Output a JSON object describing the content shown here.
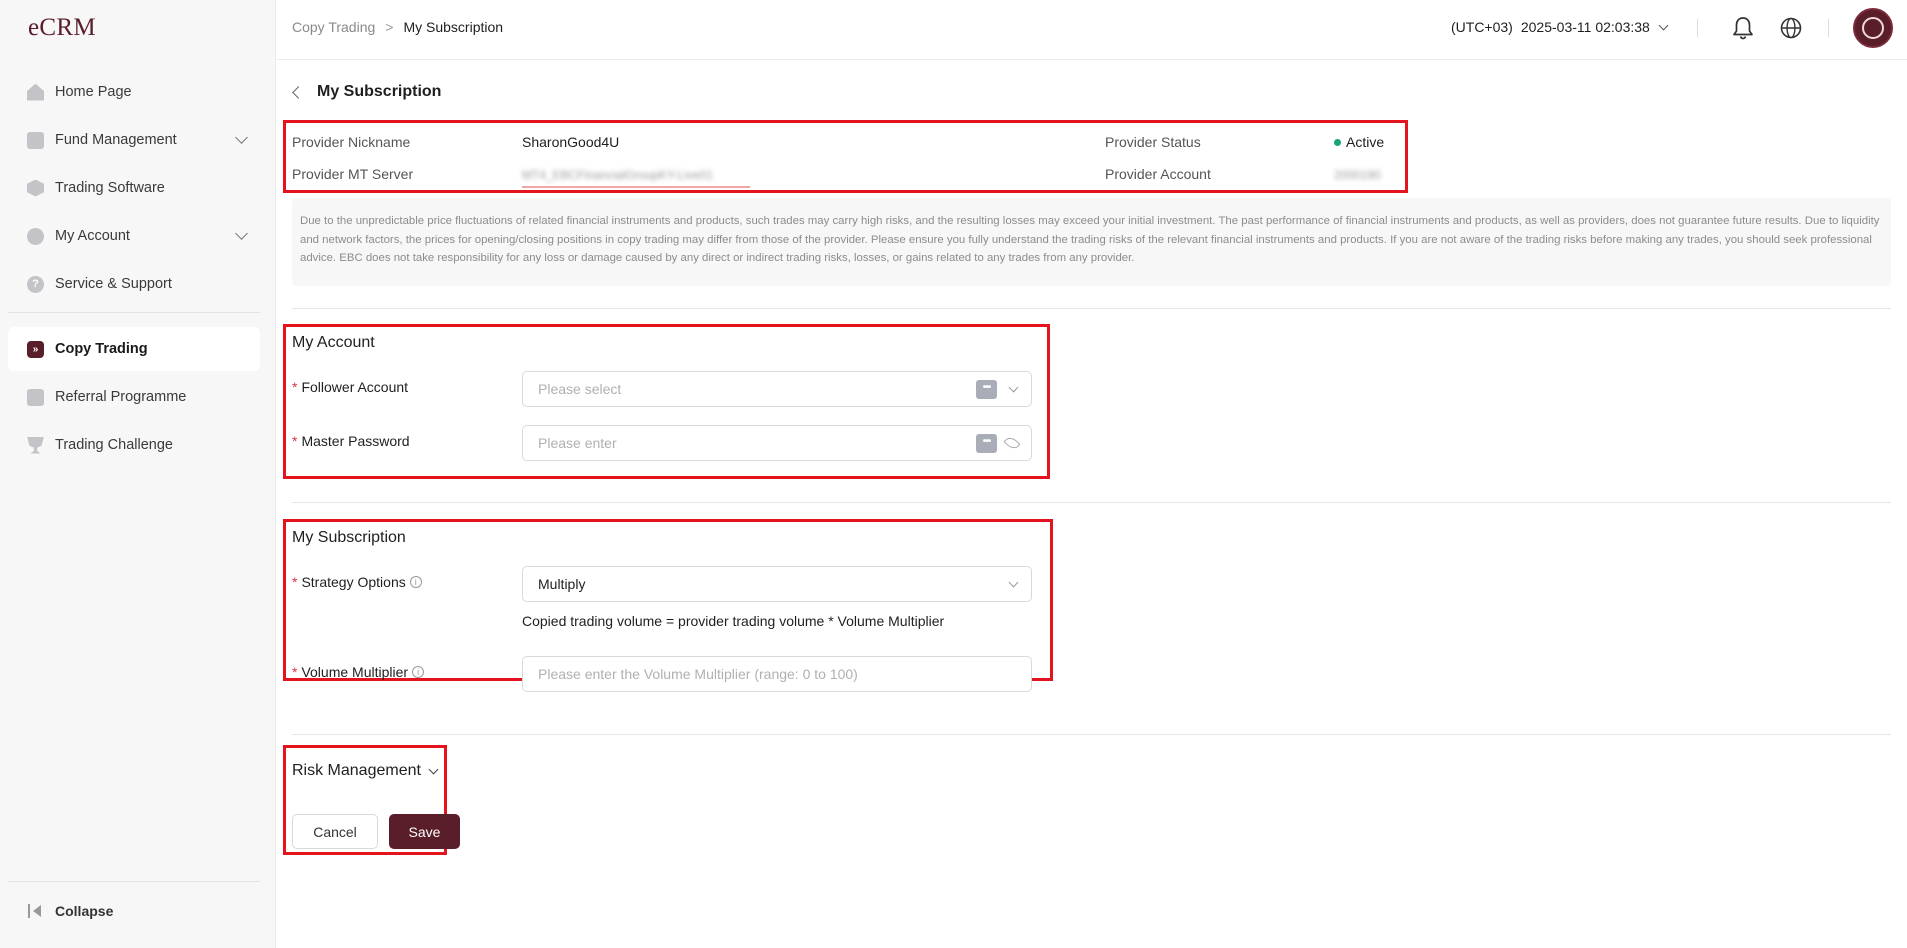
{
  "app": {
    "logo": "eCRM"
  },
  "sidebar": {
    "items": [
      {
        "label": "Home Page",
        "icon": "home-icon"
      },
      {
        "label": "Fund Management",
        "icon": "fund-icon",
        "expandable": true
      },
      {
        "label": "Trading Software",
        "icon": "cube-icon"
      },
      {
        "label": "My Account",
        "icon": "user-icon",
        "expandable": true
      },
      {
        "label": "Service & Support",
        "icon": "help-icon"
      },
      {
        "label": "Copy Trading",
        "icon": "copy-trading-icon",
        "active": true
      },
      {
        "label": "Referral Programme",
        "icon": "referral-icon"
      },
      {
        "label": "Trading Challenge",
        "icon": "trophy-icon"
      }
    ],
    "collapse_label": "Collapse"
  },
  "header": {
    "breadcrumb": {
      "parent": "Copy Trading",
      "current": "My Subscription"
    },
    "timezone": "(UTC+03)",
    "datetime": "2025-03-11 02:03:38"
  },
  "page": {
    "title": "My Subscription",
    "provider": {
      "nickname_label": "Provider Nickname",
      "nickname": "SharonGood4U",
      "status_label": "Provider Status",
      "status": "Active",
      "server_label": "Provider MT Server",
      "server": "MT4_EBCFinancialGroupKY-Live01",
      "account_label": "Provider Account",
      "account": "2000190"
    },
    "disclaimer": "Due to the unpredictable price fluctuations of related financial instruments and products, such trades may carry high risks, and the resulting losses may exceed your initial investment. The past performance of financial instruments and products, as well as providers, does not guarantee future results. Due to liquidity and network factors, the prices for opening/closing positions in copy trading may differ from those of the provider. Please ensure you fully understand the trading risks of the relevant financial instruments and products. If you are not aware of the trading risks before making any trades, you should seek professional advice. EBC does not take responsibility for any loss or damage caused by any direct or indirect trading risks, losses, or gains related to any trades from any provider.",
    "my_account": {
      "title": "My Account",
      "follower_label": "Follower Account",
      "follower_placeholder": "Please select",
      "password_label": "Master Password",
      "password_placeholder": "Please enter"
    },
    "my_subscription": {
      "title": "My Subscription",
      "strategy_label": "Strategy Options",
      "strategy_value": "Multiply",
      "formula": "Copied trading volume = provider trading volume * Volume Multiplier",
      "multiplier_label": "Volume Multiplier",
      "multiplier_placeholder": "Please enter the Volume Multiplier (range: 0 to 100)"
    },
    "risk_management": {
      "title": "Risk Management"
    },
    "buttons": {
      "cancel": "Cancel",
      "save": "Save"
    }
  },
  "colors": {
    "brand": "#5a1d2a",
    "highlight": "#e3141e",
    "active_status": "#17a673"
  }
}
